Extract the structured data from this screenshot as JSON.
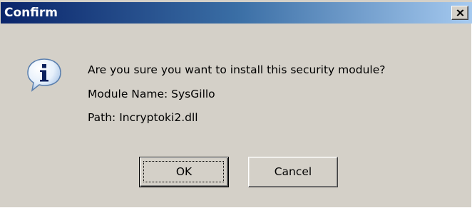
{
  "window": {
    "title": "Confirm",
    "close_label": "X"
  },
  "message": {
    "icon": "info-icon",
    "question": "Are you sure you want to install this security module?",
    "module_name": "Module Name: SysGillo",
    "path": "Path: Incryptoki2.dll"
  },
  "buttons": {
    "ok_label": "OK",
    "cancel_label": "Cancel"
  },
  "colors": {
    "titlebar_start": "#0a246a",
    "titlebar_end": "#a6caf0",
    "dialog_face": "#d4d0c8"
  }
}
